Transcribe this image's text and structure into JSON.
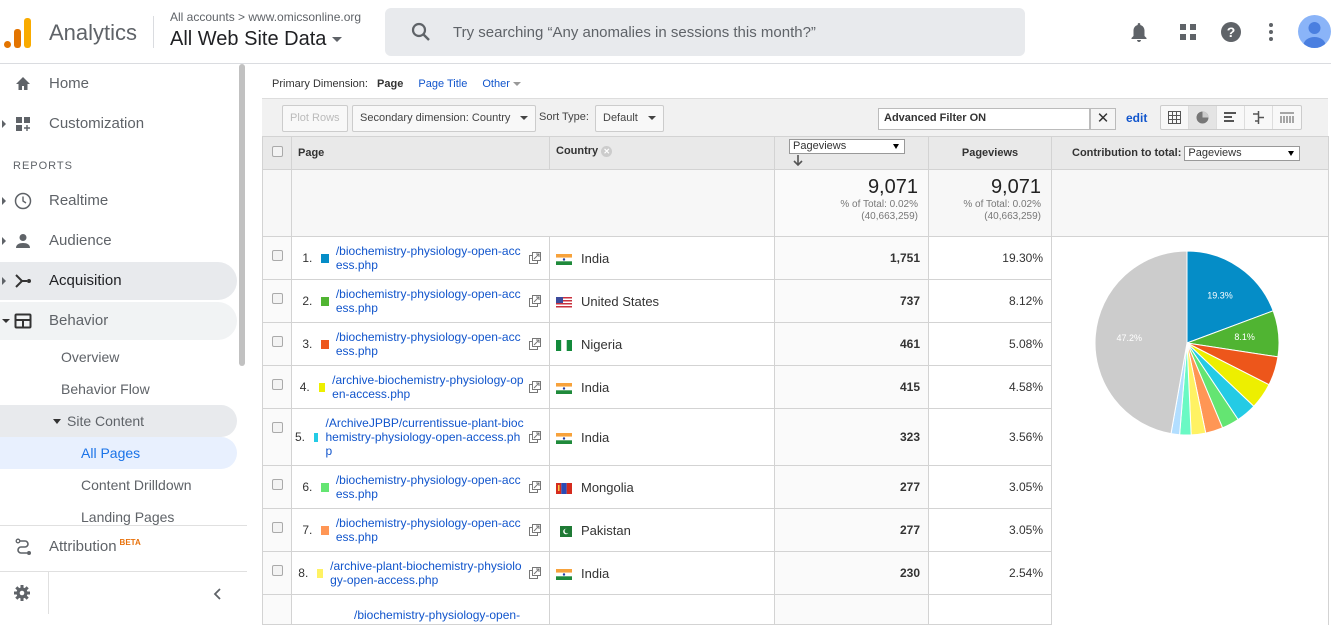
{
  "header": {
    "app_name": "Analytics",
    "breadcrumb": "All accounts > www.omicsonline.org",
    "view_name": "All Web Site Data",
    "search_placeholder": "Try searching “Any anomalies in sessions this month?”"
  },
  "sidebar": {
    "items": [
      {
        "label": "Home",
        "icon": "home-icon"
      },
      {
        "label": "Customization",
        "icon": "dashboard-icon"
      }
    ],
    "reports_label": "REPORTS",
    "report_items": [
      {
        "label": "Realtime",
        "icon": "clock-icon"
      },
      {
        "label": "Audience",
        "icon": "person-icon"
      },
      {
        "label": "Acquisition",
        "icon": "acquisition-icon"
      },
      {
        "label": "Behavior",
        "icon": "behavior-icon"
      }
    ],
    "behavior_sub": [
      "Overview",
      "Behavior Flow"
    ],
    "site_content": "Site Content",
    "site_content_sub": [
      "All Pages",
      "Content Drilldown",
      "Landing Pages"
    ],
    "attribution": "Attribution",
    "attribution_badge": "BETA"
  },
  "report": {
    "primary_dimension_label": "Primary Dimension:",
    "primary_active": "Page",
    "primary_options": [
      "Page Title",
      "Other"
    ],
    "plot_rows": "Plot Rows",
    "secondary_dimension": "Secondary dimension: Country",
    "sort_type_label": "Sort Type:",
    "sort_type_value": "Default",
    "filter_text": "Advanced Filter ON",
    "edit_label": "edit",
    "columns": {
      "page": "Page",
      "country": "Country",
      "metric_select": "Pageviews",
      "pageviews": "Pageviews",
      "contribution_label": "Contribution to total:",
      "contribution_select": "Pageviews"
    },
    "totals": {
      "value": "9,071",
      "pct_of_total": "% of Total: 0.02%",
      "grand_total": "(40,663,259)"
    },
    "rows": [
      {
        "n": "1.",
        "color": "#058dc7",
        "page": "/biochemistry-physiology-open-access.php",
        "country": "India",
        "flag": "india",
        "pageviews": "1,751",
        "pct": "19.30%"
      },
      {
        "n": "2.",
        "color": "#50b432",
        "page": "/biochemistry-physiology-open-access.php",
        "country": "United States",
        "flag": "us",
        "pageviews": "737",
        "pct": "8.12%"
      },
      {
        "n": "3.",
        "color": "#ed561b",
        "page": "/biochemistry-physiology-open-access.php",
        "country": "Nigeria",
        "flag": "nigeria",
        "pageviews": "461",
        "pct": "5.08%"
      },
      {
        "n": "4.",
        "color": "#edef00",
        "page": "/archive-biochemistry-physiology-open-access.php",
        "country": "India",
        "flag": "india",
        "pageviews": "415",
        "pct": "4.58%"
      },
      {
        "n": "5.",
        "color": "#24cbe5",
        "page": "/ArchiveJPBP/currentissue-plant-biochemistry-physiology-open-access.php",
        "country": "India",
        "flag": "india",
        "pageviews": "323",
        "pct": "3.56%"
      },
      {
        "n": "6.",
        "color": "#64e572",
        "page": "/biochemistry-physiology-open-access.php",
        "country": "Mongolia",
        "flag": "mongolia",
        "pageviews": "277",
        "pct": "3.05%"
      },
      {
        "n": "7.",
        "color": "#ff9655",
        "page": "/biochemistry-physiology-open-access.php",
        "country": "Pakistan",
        "flag": "pakistan",
        "pageviews": "277",
        "pct": "3.05%"
      },
      {
        "n": "8.",
        "color": "#fff263",
        "page": "/archive-plant-biochemistry-physiology-open-access.php",
        "country": "India",
        "flag": "india",
        "pageviews": "230",
        "pct": "2.54%"
      },
      {
        "n": "",
        "color": "",
        "page": "/biochemistry-physiology-open-",
        "country": "",
        "flag": "",
        "pageviews": "",
        "pct": ""
      }
    ]
  },
  "chart_data": {
    "type": "pie",
    "title": "Contribution to total: Pageviews",
    "slices": [
      {
        "label": "Row 1",
        "value": 19.3,
        "color": "#058dc7",
        "show_label": "19.3%"
      },
      {
        "label": "Row 2",
        "value": 8.1,
        "color": "#50b432",
        "show_label": "8.1%"
      },
      {
        "label": "Row 3",
        "value": 5.08,
        "color": "#ed561b",
        "show_label": ""
      },
      {
        "label": "Row 4",
        "value": 4.58,
        "color": "#edef00",
        "show_label": ""
      },
      {
        "label": "Row 5",
        "value": 3.56,
        "color": "#24cbe5",
        "show_label": ""
      },
      {
        "label": "Row 6",
        "value": 3.05,
        "color": "#64e572",
        "show_label": ""
      },
      {
        "label": "Row 7",
        "value": 3.05,
        "color": "#ff9655",
        "show_label": ""
      },
      {
        "label": "Row 8",
        "value": 2.54,
        "color": "#fff263",
        "show_label": ""
      },
      {
        "label": "Row 9",
        "value": 2.0,
        "color": "#6af9c4",
        "show_label": ""
      },
      {
        "label": "Row 10",
        "value": 1.5,
        "color": "#b2deff",
        "show_label": ""
      },
      {
        "label": "Other",
        "value": 47.2,
        "color": "#cccccc",
        "show_label": "47.2%"
      }
    ]
  }
}
